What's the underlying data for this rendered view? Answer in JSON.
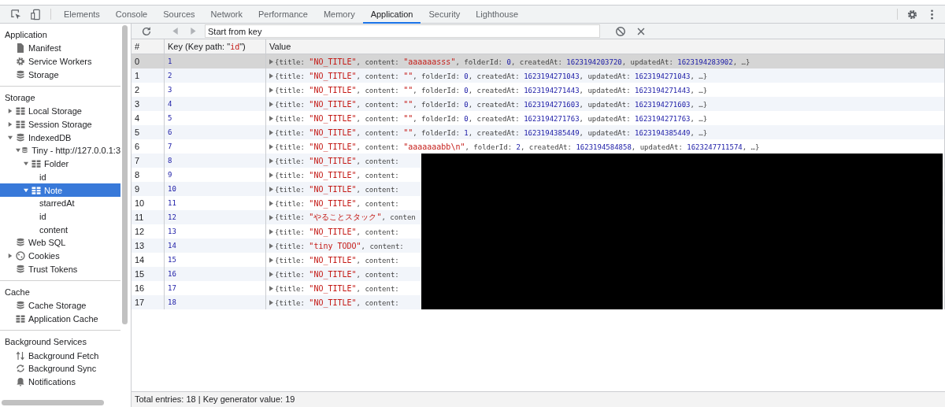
{
  "tabs": [
    {
      "label": "Elements",
      "selected": false
    },
    {
      "label": "Console",
      "selected": false
    },
    {
      "label": "Sources",
      "selected": false
    },
    {
      "label": "Network",
      "selected": false
    },
    {
      "label": "Performance",
      "selected": false
    },
    {
      "label": "Memory",
      "selected": false
    },
    {
      "label": "Application",
      "selected": true
    },
    {
      "label": "Security",
      "selected": false
    },
    {
      "label": "Lighthouse",
      "selected": false
    }
  ],
  "sidebar": {
    "sections": [
      {
        "title": "Application",
        "items": [
          {
            "label": "Manifest",
            "kind": "file",
            "selected": false
          },
          {
            "label": "Service Workers",
            "kind": "gear",
            "selected": false
          },
          {
            "label": "Storage",
            "kind": "db",
            "selected": false
          }
        ]
      },
      {
        "title": "Storage",
        "items": [
          {
            "label": "Local Storage",
            "kind": "table",
            "expanded": false,
            "selected": false
          },
          {
            "label": "Session Storage",
            "kind": "table",
            "expanded": false,
            "selected": false
          },
          {
            "label": "IndexedDB",
            "kind": "db",
            "expanded": true,
            "selected": false,
            "children": [
              {
                "label": "Tiny - http://127.0.0.1:3",
                "kind": "db",
                "expanded": true,
                "selected": false,
                "children": [
                  {
                    "label": "Folder",
                    "kind": "table",
                    "expanded": true,
                    "selected": false,
                    "children": [
                      {
                        "label": "id",
                        "kind": "none",
                        "selected": false
                      }
                    ]
                  },
                  {
                    "label": "Note",
                    "kind": "table",
                    "expanded": true,
                    "selected": true,
                    "children": [
                      {
                        "label": "starredAt",
                        "kind": "none",
                        "selected": false
                      },
                      {
                        "label": "id",
                        "kind": "none",
                        "selected": false
                      },
                      {
                        "label": "content",
                        "kind": "none",
                        "selected": false
                      }
                    ]
                  }
                ]
              }
            ]
          },
          {
            "label": "Web SQL",
            "kind": "db",
            "selected": false
          },
          {
            "label": "Cookies",
            "kind": "cookie",
            "expanded": false,
            "selected": false
          },
          {
            "label": "Trust Tokens",
            "kind": "db",
            "selected": false
          }
        ]
      },
      {
        "title": "Cache",
        "items": [
          {
            "label": "Cache Storage",
            "kind": "db",
            "selected": false
          },
          {
            "label": "Application Cache",
            "kind": "table",
            "selected": false
          }
        ]
      },
      {
        "title": "Background Services",
        "items": [
          {
            "label": "Background Fetch",
            "kind": "fetch",
            "selected": false
          },
          {
            "label": "Background Sync",
            "kind": "sync",
            "selected": false
          },
          {
            "label": "Notifications",
            "kind": "bell",
            "selected": false
          }
        ]
      }
    ]
  },
  "toolbar": {
    "search": {
      "placeholder": "Start from key"
    }
  },
  "table": {
    "columns": [
      [
        {
          "kind": "plain",
          "text": "#"
        }
      ],
      [
        {
          "kind": "plain",
          "text": "Key (Key path: \""
        },
        {
          "kind": "string",
          "text": "id"
        },
        {
          "kind": "plain",
          "text": "\")"
        }
      ],
      [
        {
          "kind": "plain",
          "text": "Value"
        }
      ]
    ],
    "rows": [
      {
        "index": "0",
        "key": "1",
        "selected": true,
        "value": [
          {
            "kind": "plain",
            "text": "{title: "
          },
          {
            "kind": "string",
            "text": "\"NO_TITLE\""
          },
          {
            "kind": "plain",
            "text": ", content: "
          },
          {
            "kind": "string",
            "text": "\"aaaaaasss\""
          },
          {
            "kind": "plain",
            "text": ", folderId: "
          },
          {
            "kind": "number",
            "text": "0"
          },
          {
            "kind": "plain",
            "text": ", createdAt: "
          },
          {
            "kind": "number",
            "text": "1623194203720"
          },
          {
            "kind": "plain",
            "text": ", updatedAt: "
          },
          {
            "kind": "number",
            "text": "1623194283902"
          },
          {
            "kind": "plain",
            "text": ", …}"
          }
        ]
      },
      {
        "index": "1",
        "key": "2",
        "selected": false,
        "value": [
          {
            "kind": "plain",
            "text": "{title: "
          },
          {
            "kind": "string",
            "text": "\"NO_TITLE\""
          },
          {
            "kind": "plain",
            "text": ", content: "
          },
          {
            "kind": "string",
            "text": "\"\""
          },
          {
            "kind": "plain",
            "text": ", folderId: "
          },
          {
            "kind": "number",
            "text": "0"
          },
          {
            "kind": "plain",
            "text": ", createdAt: "
          },
          {
            "kind": "number",
            "text": "1623194271043"
          },
          {
            "kind": "plain",
            "text": ", updatedAt: "
          },
          {
            "kind": "number",
            "text": "1623194271043"
          },
          {
            "kind": "plain",
            "text": ", …}"
          }
        ]
      },
      {
        "index": "2",
        "key": "3",
        "selected": false,
        "value": [
          {
            "kind": "plain",
            "text": "{title: "
          },
          {
            "kind": "string",
            "text": "\"NO_TITLE\""
          },
          {
            "kind": "plain",
            "text": ", content: "
          },
          {
            "kind": "string",
            "text": "\"\""
          },
          {
            "kind": "plain",
            "text": ", folderId: "
          },
          {
            "kind": "number",
            "text": "0"
          },
          {
            "kind": "plain",
            "text": ", createdAt: "
          },
          {
            "kind": "number",
            "text": "1623194271443"
          },
          {
            "kind": "plain",
            "text": ", updatedAt: "
          },
          {
            "kind": "number",
            "text": "1623194271443"
          },
          {
            "kind": "plain",
            "text": ", …}"
          }
        ]
      },
      {
        "index": "3",
        "key": "4",
        "selected": false,
        "value": [
          {
            "kind": "plain",
            "text": "{title: "
          },
          {
            "kind": "string",
            "text": "\"NO_TITLE\""
          },
          {
            "kind": "plain",
            "text": ", content: "
          },
          {
            "kind": "string",
            "text": "\"\""
          },
          {
            "kind": "plain",
            "text": ", folderId: "
          },
          {
            "kind": "number",
            "text": "0"
          },
          {
            "kind": "plain",
            "text": ", createdAt: "
          },
          {
            "kind": "number",
            "text": "1623194271603"
          },
          {
            "kind": "plain",
            "text": ", updatedAt: "
          },
          {
            "kind": "number",
            "text": "1623194271603"
          },
          {
            "kind": "plain",
            "text": ", …}"
          }
        ]
      },
      {
        "index": "4",
        "key": "5",
        "selected": false,
        "value": [
          {
            "kind": "plain",
            "text": "{title: "
          },
          {
            "kind": "string",
            "text": "\"NO_TITLE\""
          },
          {
            "kind": "plain",
            "text": ", content: "
          },
          {
            "kind": "string",
            "text": "\"\""
          },
          {
            "kind": "plain",
            "text": ", folderId: "
          },
          {
            "kind": "number",
            "text": "0"
          },
          {
            "kind": "plain",
            "text": ", createdAt: "
          },
          {
            "kind": "number",
            "text": "1623194271763"
          },
          {
            "kind": "plain",
            "text": ", updatedAt: "
          },
          {
            "kind": "number",
            "text": "1623194271763"
          },
          {
            "kind": "plain",
            "text": ", …}"
          }
        ]
      },
      {
        "index": "5",
        "key": "6",
        "selected": false,
        "value": [
          {
            "kind": "plain",
            "text": "{title: "
          },
          {
            "kind": "string",
            "text": "\"NO_TITLE\""
          },
          {
            "kind": "plain",
            "text": ", content: "
          },
          {
            "kind": "string",
            "text": "\"\""
          },
          {
            "kind": "plain",
            "text": ", folderId: "
          },
          {
            "kind": "number",
            "text": "1"
          },
          {
            "kind": "plain",
            "text": ", createdAt: "
          },
          {
            "kind": "number",
            "text": "1623194385449"
          },
          {
            "kind": "plain",
            "text": ", updatedAt: "
          },
          {
            "kind": "number",
            "text": "1623194385449"
          },
          {
            "kind": "plain",
            "text": ", …}"
          }
        ]
      },
      {
        "index": "6",
        "key": "7",
        "selected": false,
        "value": [
          {
            "kind": "plain",
            "text": "{title: "
          },
          {
            "kind": "string",
            "text": "\"NO_TITLE\""
          },
          {
            "kind": "plain",
            "text": ", content: "
          },
          {
            "kind": "string",
            "text": "\"aaaaaaabb\\n\""
          },
          {
            "kind": "plain",
            "text": ", folderId: "
          },
          {
            "kind": "number",
            "text": "2"
          },
          {
            "kind": "plain",
            "text": ", createdAt: "
          },
          {
            "kind": "number",
            "text": "1623194584858"
          },
          {
            "kind": "plain",
            "text": ", updatedAt: "
          },
          {
            "kind": "number",
            "text": "1623247711574"
          },
          {
            "kind": "plain",
            "text": ", …}"
          }
        ]
      },
      {
        "index": "7",
        "key": "8",
        "selected": false,
        "value": [
          {
            "kind": "plain",
            "text": "{title: "
          },
          {
            "kind": "string",
            "text": "\"NO_TITLE\""
          },
          {
            "kind": "plain",
            "text": ", content:"
          }
        ]
      },
      {
        "index": "8",
        "key": "9",
        "selected": false,
        "value": [
          {
            "kind": "plain",
            "text": "{title: "
          },
          {
            "kind": "string",
            "text": "\"NO_TITLE\""
          },
          {
            "kind": "plain",
            "text": ", content:"
          }
        ]
      },
      {
        "index": "9",
        "key": "10",
        "selected": false,
        "value": [
          {
            "kind": "plain",
            "text": "{title: "
          },
          {
            "kind": "string",
            "text": "\"NO_TITLE\""
          },
          {
            "kind": "plain",
            "text": ", content:"
          }
        ]
      },
      {
        "index": "10",
        "key": "11",
        "selected": false,
        "value": [
          {
            "kind": "plain",
            "text": "{title: "
          },
          {
            "kind": "string",
            "text": "\"NO_TITLE\""
          },
          {
            "kind": "plain",
            "text": ", content:"
          }
        ]
      },
      {
        "index": "11",
        "key": "12",
        "selected": false,
        "value": [
          {
            "kind": "plain",
            "text": "{title: "
          },
          {
            "kind": "string",
            "text": "\"やることスタック\""
          },
          {
            "kind": "plain",
            "text": ", conten"
          }
        ]
      },
      {
        "index": "12",
        "key": "13",
        "selected": false,
        "value": [
          {
            "kind": "plain",
            "text": "{title: "
          },
          {
            "kind": "string",
            "text": "\"NO_TITLE\""
          },
          {
            "kind": "plain",
            "text": ", content:"
          }
        ]
      },
      {
        "index": "13",
        "key": "14",
        "selected": false,
        "value": [
          {
            "kind": "plain",
            "text": "{title: "
          },
          {
            "kind": "string",
            "text": "\"tiny TODO\""
          },
          {
            "kind": "plain",
            "text": ", content:"
          }
        ]
      },
      {
        "index": "14",
        "key": "15",
        "selected": false,
        "value": [
          {
            "kind": "plain",
            "text": "{title: "
          },
          {
            "kind": "string",
            "text": "\"NO_TITLE\""
          },
          {
            "kind": "plain",
            "text": ", content:"
          }
        ]
      },
      {
        "index": "15",
        "key": "16",
        "selected": false,
        "value": [
          {
            "kind": "plain",
            "text": "{title: "
          },
          {
            "kind": "string",
            "text": "\"NO_TITLE\""
          },
          {
            "kind": "plain",
            "text": ", content:"
          }
        ]
      },
      {
        "index": "16",
        "key": "17",
        "selected": false,
        "value": [
          {
            "kind": "plain",
            "text": "{title: "
          },
          {
            "kind": "string",
            "text": "\"NO_TITLE\""
          },
          {
            "kind": "plain",
            "text": ", content:"
          }
        ]
      },
      {
        "index": "17",
        "key": "18",
        "selected": false,
        "value": [
          {
            "kind": "plain",
            "text": "{title: "
          },
          {
            "kind": "string",
            "text": "\"NO_TITLE\""
          },
          {
            "kind": "plain",
            "text": ", content:"
          }
        ]
      }
    ]
  },
  "status_bar": "Total entries: 18 | Key generator value: 19"
}
